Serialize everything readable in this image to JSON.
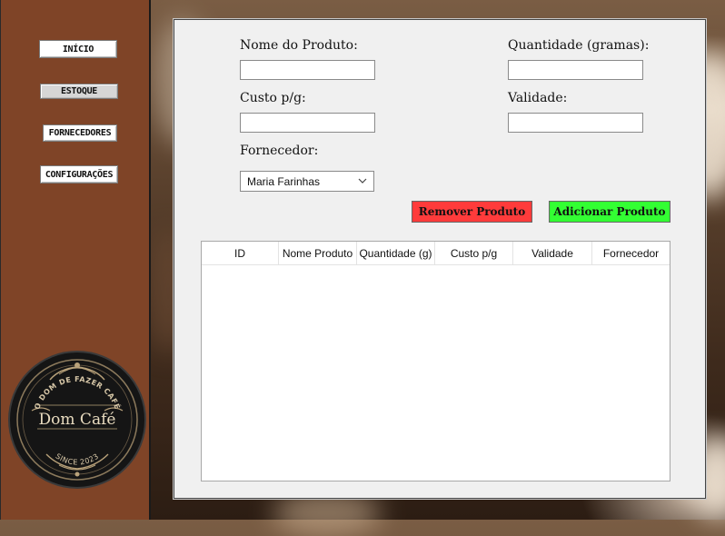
{
  "sidebar": {
    "items": [
      {
        "label": "INÍCIO",
        "active": false
      },
      {
        "label": "ESTOQUE",
        "active": true
      },
      {
        "label": "FORNECEDORES",
        "active": false
      },
      {
        "label": "CONFIGURAÇÕES",
        "active": false
      }
    ],
    "logo": {
      "name": "Dom Café",
      "tagline": "O DOM DE FAZER CAFÉ",
      "since": "SINCE 2023"
    }
  },
  "form": {
    "nome_label": "Nome do Produto:",
    "nome_value": "",
    "quantidade_label": "Quantidade (gramas):",
    "quantidade_value": "",
    "custo_label": "Custo p/g:",
    "custo_value": "",
    "validade_label": "Validade:",
    "validade_value": "",
    "fornecedor_label": "Fornecedor:",
    "fornecedor_selected": "Maria Farinhas"
  },
  "actions": {
    "remove_label": "Remover Produto",
    "add_label": "Adicionar Produto",
    "remove_color": "#ff3b3b",
    "add_color": "#33ff33"
  },
  "table": {
    "columns": [
      "ID",
      "Nome Produto",
      "Quantidade (g)",
      "Custo p/g",
      "Validade",
      "Fornecedor"
    ],
    "rows": []
  },
  "colors": {
    "sidebar": "#7f4427",
    "panel": "#f0f0f0"
  }
}
